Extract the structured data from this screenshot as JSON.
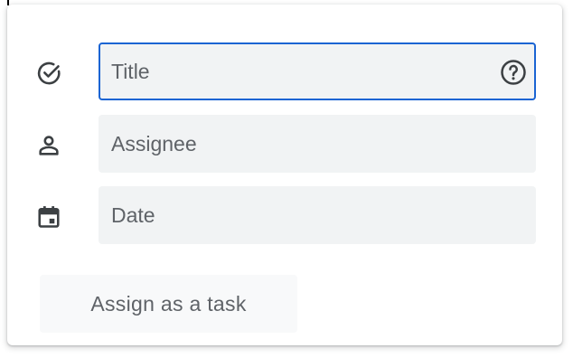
{
  "form": {
    "title_field": {
      "value": "",
      "placeholder": "Title",
      "focused": true,
      "help_icon": "help-circle-icon",
      "leading_icon": "check-circle-icon"
    },
    "assignee_field": {
      "value": "",
      "placeholder": "Assignee",
      "leading_icon": "person-icon"
    },
    "date_field": {
      "value": "",
      "placeholder": "Date",
      "leading_icon": "calendar-icon"
    },
    "assign_button_label": "Assign as a task"
  },
  "colors": {
    "focus_border": "#1a64d3",
    "field_background": "#f1f3f4",
    "icon": "#3c4043",
    "placeholder_text": "#5f6368"
  }
}
